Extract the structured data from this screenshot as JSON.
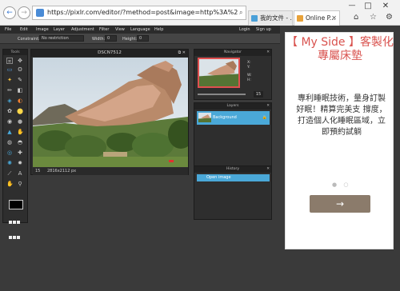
{
  "browser": {
    "url": "https://pixlr.com/editor/?method=post&image=http%3A%2F%2F",
    "tabs": [
      {
        "label": "我的文件 - ..."
      },
      {
        "label": "Online P..."
      }
    ],
    "nav": {
      "back": "←",
      "forward": "→",
      "search": "⌕",
      "lock": "🔒",
      "refresh": "⟳",
      "close": "✕"
    },
    "window": {
      "minimize": "—",
      "restore": "□",
      "close": "✕"
    }
  },
  "menu": {
    "items": [
      "File",
      "Edit",
      "Image",
      "Layer",
      "Adjustment",
      "Filter",
      "View",
      "Language",
      "Help"
    ],
    "login": "Login",
    "signup": "Sign up"
  },
  "options": {
    "constraint_label": "Constraint:",
    "constraint_value": "No restriction",
    "width_label": "Width:",
    "width_value": "0",
    "height_label": "Height:",
    "height_value": "0"
  },
  "tools": {
    "title": "Tools"
  },
  "document": {
    "title": "DSCN7512",
    "zoom": "15",
    "size": "2816x2112 px"
  },
  "navigator": {
    "title": "Navigator",
    "x_label": "X:",
    "y_label": "Y:",
    "w_label": "W:",
    "h_label": "H:",
    "zoom": "15"
  },
  "layers": {
    "title": "Layers",
    "items": [
      {
        "name": "Background"
      }
    ]
  },
  "history": {
    "title": "History",
    "items": [
      {
        "name": "Open image"
      }
    ]
  },
  "ad": {
    "headline": "【 My Side 】客製化專屬床墊",
    "body": "專利睡眠技術，量身訂製好眠！精算完美支 撐度，打造個人化睡眠區域，立即預約試躺",
    "button_arrow": "→"
  },
  "colors": {
    "accent": "#4aa8d8",
    "ad_headline": "#d9534f",
    "ad_button": "#8b7b6b"
  }
}
